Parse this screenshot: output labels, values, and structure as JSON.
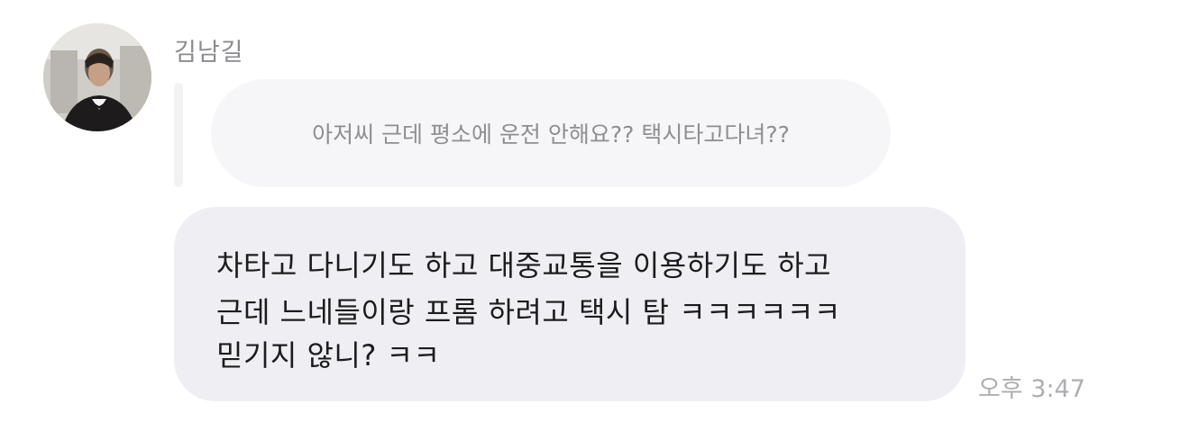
{
  "chat": {
    "sender_name": "김남길",
    "avatar_icon": "profile-photo",
    "reply_preview": "아저씨 근데 평소에 운전 안해요?? 택시타고다녀??",
    "message_lines": [
      "차타고 다니기도 하고 대중교통을 이용하기도 하고",
      "근데 느네들이랑 프롬 하려고 택시 탐 ㅋㅋㅋㅋㅋㅋ",
      "믿기지 않니? ㅋㅋ"
    ],
    "timestamp": "오후 3:47"
  },
  "colors": {
    "bubble": "#efeff3",
    "reply_bubble": "#f6f6f9",
    "sender_text": "#8b8b90",
    "message_text": "#1c1c1e",
    "timestamp_text": "#aeaeb2"
  }
}
